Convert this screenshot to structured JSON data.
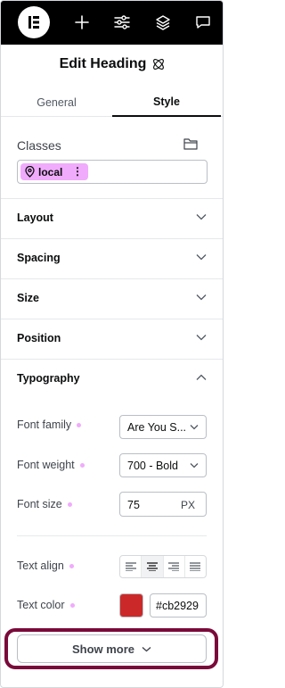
{
  "panel": {
    "title": "Edit Heading"
  },
  "tabs": [
    {
      "label": "General",
      "active": false
    },
    {
      "label": "Style",
      "active": true
    }
  ],
  "classes": {
    "label": "Classes",
    "chip": "local"
  },
  "sections": [
    {
      "label": "Layout",
      "expanded": false
    },
    {
      "label": "Spacing",
      "expanded": false
    },
    {
      "label": "Size",
      "expanded": false
    },
    {
      "label": "Position",
      "expanded": false
    },
    {
      "label": "Typography",
      "expanded": true
    }
  ],
  "typography": {
    "font_family": {
      "label": "Font family",
      "value": "Are You S..."
    },
    "font_weight": {
      "label": "Font weight",
      "value": "700 - Bold"
    },
    "font_size": {
      "label": "Font size",
      "value": "75",
      "unit": "PX"
    },
    "text_align": {
      "label": "Text align",
      "selected": "center"
    },
    "text_color": {
      "label": "Text color",
      "value": "#cb2929"
    }
  },
  "show_more": {
    "label": "Show more"
  },
  "colors": {
    "accent_pink": "#f0abfc",
    "swatch": "#cb2929",
    "highlight": "#7a0a3a"
  }
}
